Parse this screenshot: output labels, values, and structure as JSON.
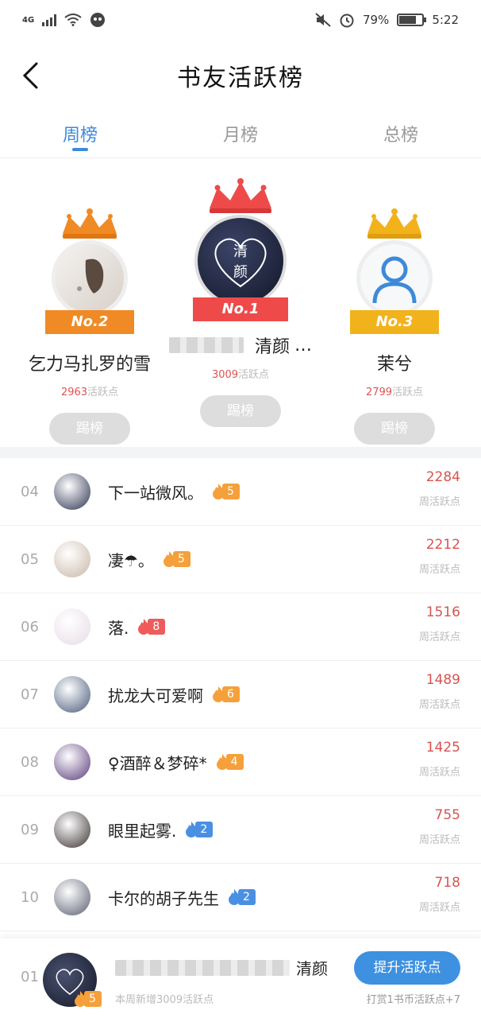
{
  "status_bar": {
    "network": "4G",
    "battery": "79%",
    "battery_level": 0.79,
    "time": "5:22"
  },
  "header": {
    "title": "书友活跃榜"
  },
  "tabs": [
    {
      "label": "周榜",
      "active": true
    },
    {
      "label": "月榜",
      "active": false
    },
    {
      "label": "总榜",
      "active": false
    }
  ],
  "podium": {
    "first": {
      "rank_label": "No.1",
      "name": "清颜",
      "name_suffix": "…",
      "points_value": "3009",
      "points_unit": "活跃点",
      "kick_label": "踢榜",
      "avatar_text_1": "清",
      "avatar_text_2": "颜"
    },
    "second": {
      "rank_label": "No.2",
      "name": "乞力马扎罗的雪",
      "points_value": "2963",
      "points_unit": "活跃点",
      "kick_label": "踢榜"
    },
    "third": {
      "rank_label": "No.3",
      "name": "茉兮",
      "points_value": "2799",
      "points_unit": "活跃点",
      "kick_label": "踢榜"
    }
  },
  "rank_list": [
    {
      "rank": "04",
      "name": "下一站微风。",
      "level": "5",
      "score": "2284",
      "score_label": "周活跃点",
      "badge_color": "#f5a03a",
      "avatar_color": "#2c3350"
    },
    {
      "rank": "05",
      "name": "凄☂。",
      "level": "5",
      "score": "2212",
      "score_label": "周活跃点",
      "badge_color": "#f5a03a",
      "avatar_color": "#c9b7a8"
    },
    {
      "rank": "06",
      "name": "落.",
      "level": "8",
      "score": "1516",
      "score_label": "周活跃点",
      "badge_color": "#ef5b5b",
      "avatar_color": "#e8dbe6"
    },
    {
      "rank": "07",
      "name": "扰龙大可爱啊",
      "level": "6",
      "score": "1489",
      "score_label": "周活跃点",
      "badge_color": "#f5a03a",
      "avatar_color": "#485a7a"
    },
    {
      "rank": "08",
      "name": "♀酒醉＆梦碎*",
      "level": "4",
      "score": "1425",
      "score_label": "周活跃点",
      "badge_color": "#f5a03a",
      "avatar_color": "#5a3a7a"
    },
    {
      "rank": "09",
      "name": "眼里起雾.",
      "level": "2",
      "score": "755",
      "score_label": "周活跃点",
      "badge_color": "#4a90e2",
      "avatar_color": "#3a3230"
    },
    {
      "rank": "10",
      "name": "卡尔的胡子先生",
      "level": "2",
      "score": "718",
      "score_label": "周活跃点",
      "badge_color": "#4a90e2",
      "avatar_color": "#5a5e70"
    }
  ],
  "my_rank": {
    "rank": "01",
    "name": "清颜",
    "level": "5",
    "sub_prefix": "本周新增",
    "sub_value": "3009",
    "sub_suffix": "活跃点",
    "boost_label": "提升活跃点",
    "hint": "打赏1书币活跃点+7"
  },
  "colors": {
    "accent": "#3d8ad9",
    "score": "#d9534f",
    "gold": "#f2b21b",
    "red_crown": "#ef4a4a",
    "orange_crown": "#f08a24"
  }
}
